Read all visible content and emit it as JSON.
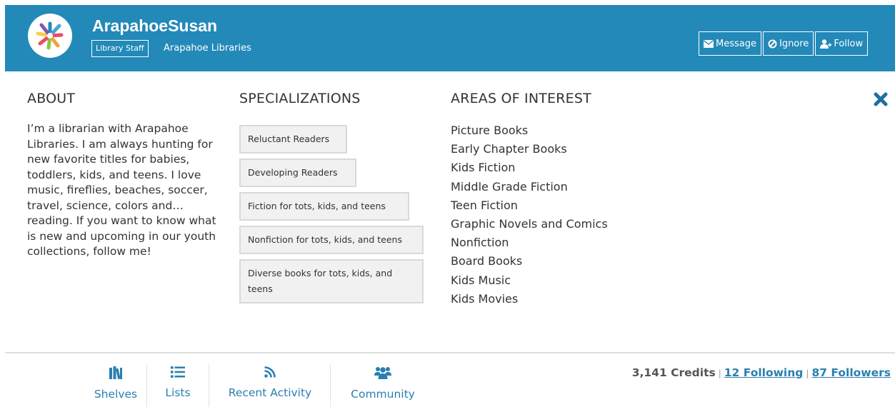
{
  "profile": {
    "username": "ArapahoeSusan",
    "badge": "Library Staff",
    "library": "Arapahoe Libraries"
  },
  "actions": {
    "message": "Message",
    "ignore": "Ignore",
    "follow": "Follow"
  },
  "about": {
    "title": "ABOUT",
    "text": "I’m a librarian with Arapahoe Libraries.  I am always hunting for new favorite titles for babies, toddlers, kids, and teens.  I love music, fireflies, beaches, soccer, travel, science, colors and… reading.  If you want to know what is new and upcoming in our youth collections, follow me!"
  },
  "specializations": {
    "title": "SPECIALIZATIONS",
    "items": [
      "Reluctant Readers",
      "Developing Readers",
      "Fiction for tots, kids, and teens",
      "Nonfiction for tots, kids, and teens",
      "Diverse books for tots, kids, and teens"
    ]
  },
  "interests": {
    "title": "AREAS OF INTEREST",
    "items": [
      "Picture Books",
      "Early Chapter Books",
      "Kids Fiction",
      "Middle Grade Fiction",
      "Teen Fiction",
      "Graphic Novels and Comics",
      "Nonfiction",
      "Board Books",
      "Kids Music",
      "Kids Movies"
    ]
  },
  "tabs": [
    {
      "label": "Shelves",
      "icon": "books-icon"
    },
    {
      "label": "Lists",
      "icon": "list-icon"
    },
    {
      "label": "Recent Activity",
      "icon": "rss-icon"
    },
    {
      "label": "Community",
      "icon": "users-icon"
    }
  ],
  "stats": {
    "credits": "3,141 Credits",
    "separator": "|",
    "following": "12 Following",
    "followers": "87 Followers"
  },
  "colors": {
    "header_bg": "#2389b8",
    "link": "#2a7fb0",
    "close_icon": "#1f6fa0"
  }
}
